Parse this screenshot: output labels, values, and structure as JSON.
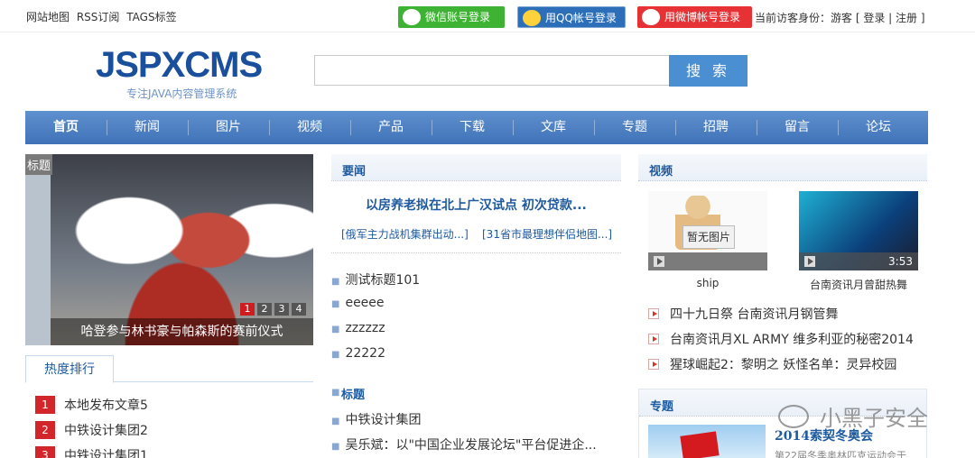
{
  "topbar": {
    "links": [
      "网站地图",
      "RSS订阅",
      "TAGS标签"
    ],
    "wechat_login": "微信账号登录",
    "qq_login": "用QQ帐号登录",
    "weibo_login": "用微博帐号登录",
    "visitor_prefix": "当前访客身份：游客 [",
    "login": "登录",
    "sep": "|",
    "register": "注册",
    "visitor_suffix": "]"
  },
  "header": {
    "logo": "JSPXCMS",
    "slogan": "专注JAVA内容管理系统",
    "search_placeholder": "",
    "search_button": "搜 索"
  },
  "nav": [
    "首页",
    "新闻",
    "图片",
    "视频",
    "产品",
    "下载",
    "文库",
    "专题",
    "招聘",
    "留言",
    "论坛"
  ],
  "slideshow": {
    "tag": "标题",
    "caption": "哈登参与林书豪与帕森斯的赛前仪式",
    "pages": [
      "1",
      "2",
      "3",
      "4"
    ]
  },
  "hot": {
    "tab": "热度排行",
    "items": [
      {
        "rank": "1",
        "title": "本地发布文章5"
      },
      {
        "rank": "2",
        "title": "中铁设计集团2"
      },
      {
        "rank": "3",
        "title": "中铁设计集团1"
      }
    ]
  },
  "news": {
    "section": "要闻",
    "headline": "以房养老拟在北上广汉试点 初次贷款...",
    "sub1": "[俄军主力战机集群出动...]",
    "sub2": "[31省市最理想伴侣地图...]",
    "items": [
      "测试标题101",
      "eeeee",
      "zzzzzz",
      "22222"
    ],
    "section2": "标题",
    "items2": [
      "中铁设计集团",
      "吴乐斌：以\"中国企业发展论坛\"平台促进企..."
    ]
  },
  "video": {
    "section": "视频",
    "thumb1_placeholder": "暂无图片",
    "thumb1_caption": "ship",
    "thumb2_duration": "3:53",
    "thumb2_caption": "台南资讯月曾甜热舞",
    "items": [
      "四十九日祭 台南资讯月钢管舞",
      "台南资讯月XL ARMY 维多利亚的秘密2014",
      "猩球崛起2：黎明之 妖怪名单：灵异校园"
    ]
  },
  "topic": {
    "section": "专题",
    "title": "2014索契冬奥会",
    "desc": "第22届冬季奥林匹克运动会于"
  },
  "watermark": "小黑子安全"
}
